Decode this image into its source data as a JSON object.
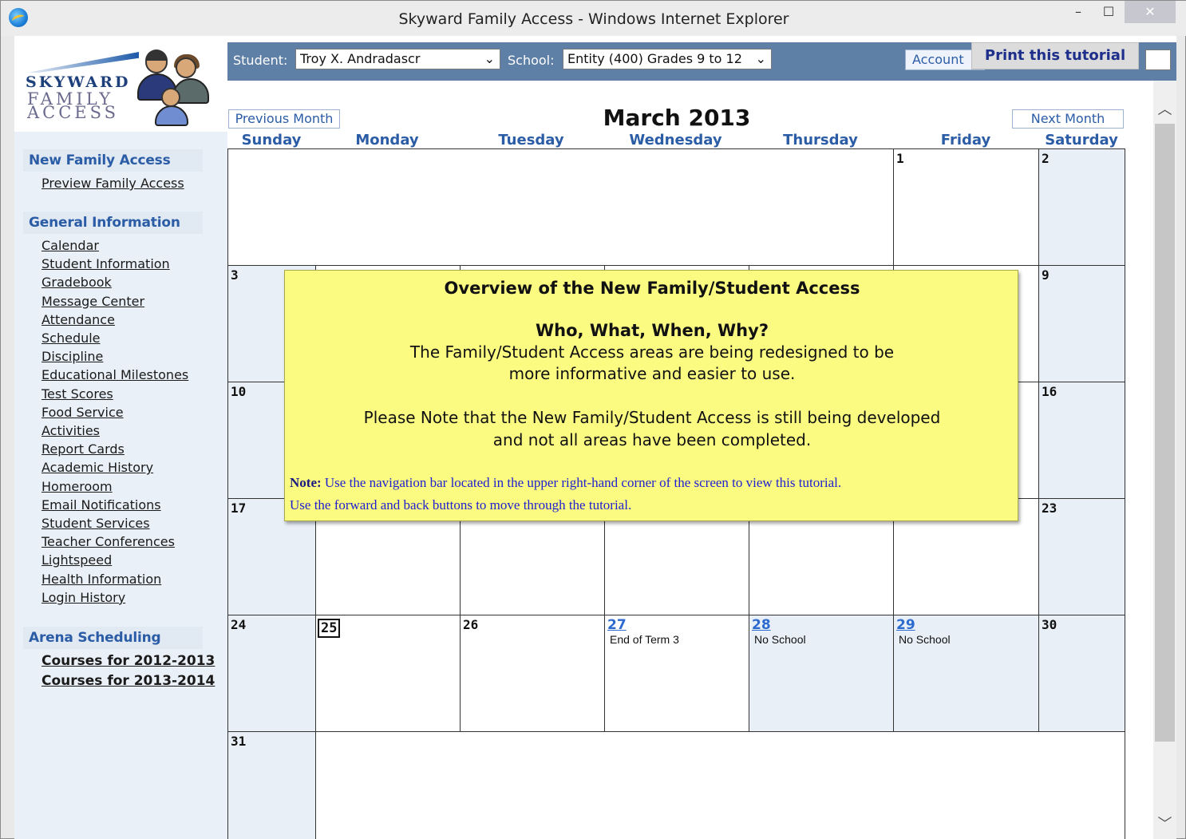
{
  "window": {
    "title": "Skyward Family Access - Windows Internet Explorer",
    "minimize_glyph": "–",
    "maximize_glyph": "☐",
    "close_glyph": "✕"
  },
  "logo": {
    "line1": "SKYWARD",
    "line2": "FAMILY",
    "line3": "ACCESS"
  },
  "sidebar": {
    "sections": [
      {
        "header": "New Family Access",
        "links": [
          "Preview Family Access"
        ]
      },
      {
        "header": "General Information",
        "links": [
          "Calendar",
          "Student Information",
          "Gradebook",
          "Message Center",
          "Attendance",
          "Schedule",
          "Discipline",
          "Educational Milestones",
          "Test Scores",
          "Food Service",
          "Activities",
          "Report Cards",
          "Academic History",
          "Homeroom",
          "Email Notifications",
          "Student Services",
          "Teacher Conferences",
          "Lightspeed",
          "Health Information",
          "Login History"
        ]
      },
      {
        "header": "Arena Scheduling",
        "links": [
          "Courses for 2012-2013",
          "Courses for 2013-2014"
        ]
      }
    ]
  },
  "topbar": {
    "student_label": "Student:",
    "student_value": "Troy X. Andradascr",
    "school_label": "School:",
    "school_value": "Entity (400) Grades 9 to 12",
    "account_label": "Account",
    "print_label": "Print this tutorial"
  },
  "calendar": {
    "prev_label": "Previous Month",
    "next_label": "Next Month",
    "month_title": "March 2013",
    "days_of_week": [
      "Sunday",
      "Monday",
      "Tuesday",
      "Wednesday",
      "Thursday",
      "Friday",
      "Saturday"
    ],
    "days": {
      "d1": "1",
      "d2": "2",
      "d3": "3",
      "d9": "9",
      "d10": "10",
      "d16": "16",
      "d17": "17",
      "d23": "23",
      "d24": "24",
      "d25": "25",
      "d26": "26",
      "d27": "27",
      "d28": "28",
      "d29": "29",
      "d30": "30",
      "d31": "31"
    },
    "events": {
      "d27": "End of Term 3",
      "d28": "No School",
      "d29": "No School"
    }
  },
  "tutorial": {
    "title": "Overview of the New Family/Student Access",
    "subtitle": "Who, What, When, Why?",
    "line1": "The Family/Student Access areas are being redesigned to be",
    "line2": "more informative and easier to use.",
    "line3": "Please Note that the New Family/Student Access is still being developed",
    "line4": "and not all areas have been completed.",
    "note_label": "Note:",
    "note_text": " Use the navigation bar located in the upper right-hand corner of the screen to view this tutorial.",
    "note_line2": "Use the forward and back buttons to move through the tutorial."
  },
  "scrollbar": {
    "up_glyph": "︿",
    "down_glyph": "﹀"
  }
}
